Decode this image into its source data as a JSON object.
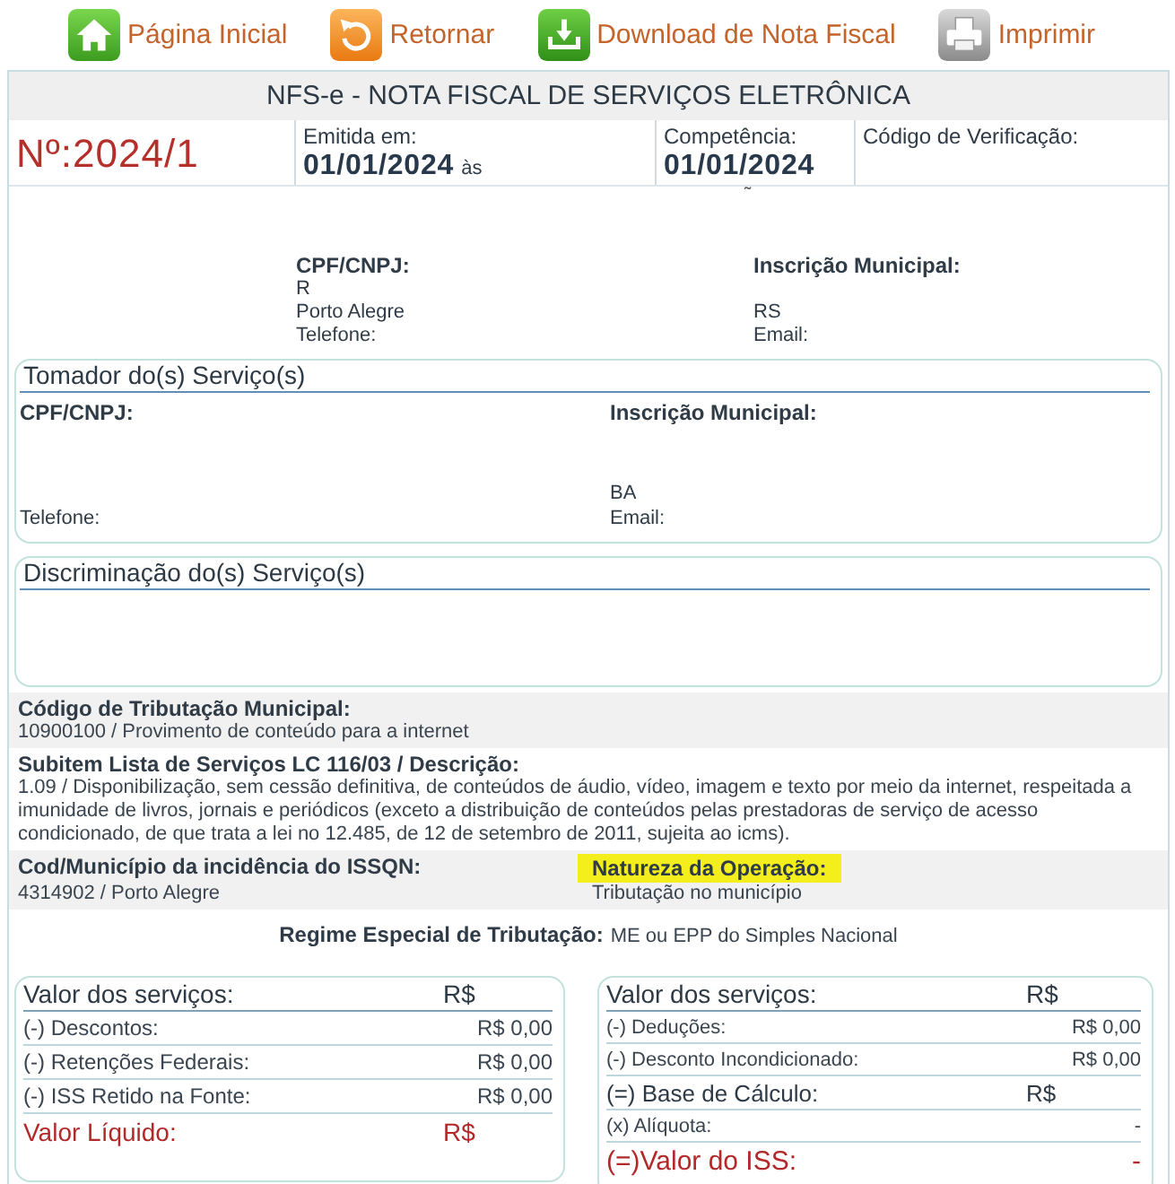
{
  "toolbar": [
    {
      "kind": "home",
      "label": "Página Inicial"
    },
    {
      "kind": "back",
      "label": "Retornar"
    },
    {
      "kind": "download",
      "label": "Download de Nota Fiscal"
    },
    {
      "kind": "print",
      "label": "Imprimir"
    }
  ],
  "document": {
    "title": "NFS-e - NOTA FISCAL DE SERVIÇOS ELETRÔNICA",
    "number": "Nº:2024/1",
    "issued": {
      "label": "Emitida em:",
      "date": "01/01/2024",
      "time_prefix": "às"
    },
    "competence": {
      "label": "Competência:",
      "date": "01/01/2024"
    },
    "verification_code": {
      "label": "Código de Verificação:"
    },
    "stray_mark": "˜"
  },
  "provider": {
    "cpf_cnpj_label": "CPF/CNPJ:",
    "name": "R",
    "city": "Porto Alegre",
    "phone_label": "Telefone:",
    "municipal_registration_label": "Inscrição Municipal:",
    "state": "RS",
    "email_label": "Email:"
  },
  "customer": {
    "title": "Tomador do(s) Serviço(s)",
    "cpf_cnpj_label": "CPF/CNPJ:",
    "municipal_registration_label": "Inscrição Municipal:",
    "state": "BA",
    "phone_label": "Telefone:",
    "email_label": "Email:"
  },
  "description": {
    "title": "Discriminação do(s) Serviço(s)"
  },
  "tax_code": {
    "label": "Código de Tributação Municipal:",
    "value": "10900100 / Provimento de conteúdo para a internet"
  },
  "service_item": {
    "label": "Subitem Lista de Serviços LC 116/03 / Descrição:",
    "value": "1.09 / Disponibilização, sem cessão definitiva, de conteúdos de áudio, vídeo, imagem e texto por meio da internet, respeitada a imunidade de livros, jornais e periódicos (exceto a distribuição de conteúdos pelas prestadoras de serviço de acesso condicionado, de que trata a lei no 12.485, de 12 de setembro de 2011, sujeita ao icms)."
  },
  "incidence": {
    "label": "Cod/Município da incidência do ISSQN:",
    "value": "4314902 / Porto Alegre"
  },
  "operation_nature": {
    "label": "Natureza da Operação:",
    "value": "Tributação no município",
    "highlighted": true
  },
  "special_regime": {
    "label": "Regime Especial de Tributação:",
    "value": "ME ou EPP do Simples Nacional"
  },
  "totals": [
    {
      "rows": [
        {
          "kind": "header",
          "label": "Valor dos serviços:",
          "value": "R$"
        },
        {
          "kind": "item",
          "label": "(-) Descontos:",
          "value": "R$ 0,00"
        },
        {
          "kind": "item",
          "label": "(-) Retenções Federais:",
          "value": "R$ 0,00"
        },
        {
          "kind": "item",
          "label": "(-) ISS Retido na Fonte:",
          "value": "R$ 0,00"
        },
        {
          "kind": "net_total",
          "label": "Valor Líquido:",
          "value": "R$"
        }
      ]
    },
    {
      "rows": [
        {
          "kind": "header",
          "label": "Valor dos serviços:",
          "value": "R$"
        },
        {
          "kind": "small_item",
          "label": "(-) Deduções:",
          "value": "R$ 0,00"
        },
        {
          "kind": "small_item",
          "label": "(-) Desconto Incondicionado:",
          "value": "R$ 0,00"
        },
        {
          "kind": "subtotal",
          "label": "(=) Base de Cálculo:",
          "value": "R$"
        },
        {
          "kind": "small_item",
          "label": "(x) Alíquota:",
          "value": "-"
        },
        {
          "kind": "tax_total",
          "label": "(=)Valor do ISS:",
          "value": "-"
        }
      ]
    }
  ]
}
